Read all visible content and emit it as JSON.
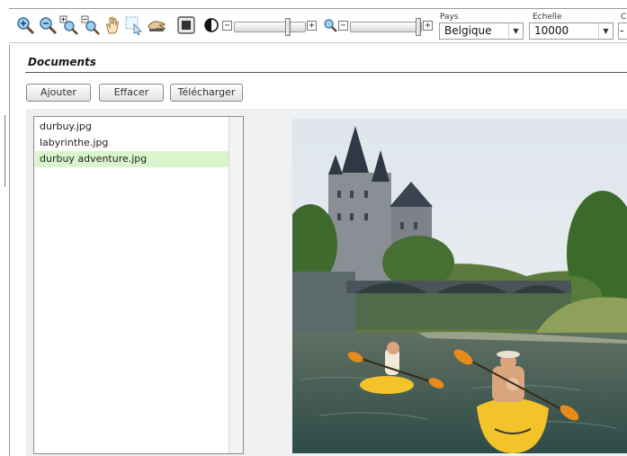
{
  "toolbar": {
    "icons": [
      "zoom-in-icon",
      "zoom-out-icon",
      "zoom-box-in-icon",
      "zoom-box-out-icon",
      "pan-hand-icon",
      "select-area-icon",
      "measure-hand-icon",
      "full-extent-icon",
      "contrast-icon",
      "zoom-icon"
    ],
    "contrast_slider": {
      "level": 0.78
    },
    "zoom_slider": {
      "level": 1.0
    },
    "pays": {
      "label": "Pays",
      "value": "Belgique"
    },
    "echelle": {
      "label": "Echelle",
      "value": "10000"
    },
    "third": {
      "label": "C",
      "value": "-"
    }
  },
  "documents": {
    "title": "Documents",
    "buttons": {
      "add": "Ajouter",
      "clear": "Effacer",
      "download": "Télécharger"
    },
    "files": [
      "durbuy.jpg",
      "labyrinthe.jpg",
      "durbuy adventure.jpg"
    ],
    "selected_file": "durbuy adventure.jpg",
    "preview_icon": "photo-preview"
  },
  "colors": {
    "selection": "#d8f5cc",
    "water": "#3f5a52",
    "kayak": "#f2c429",
    "castle": "#7d8288"
  }
}
